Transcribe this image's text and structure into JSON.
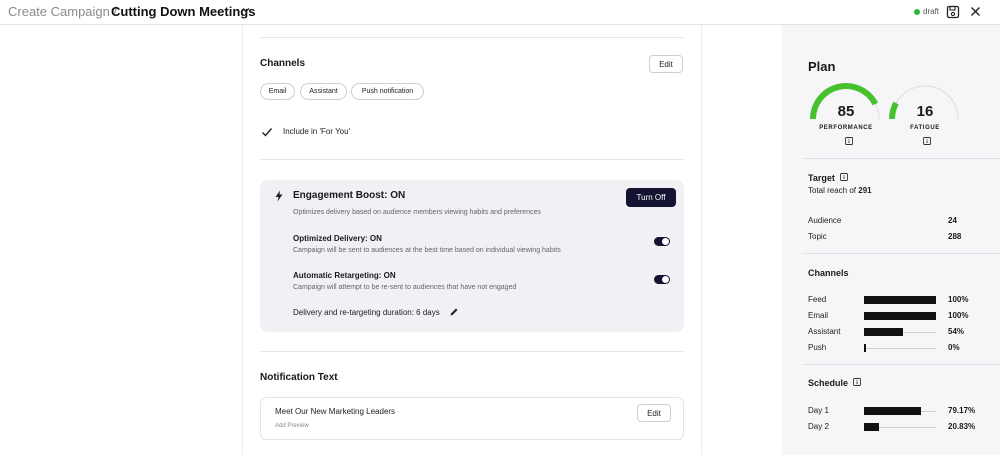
{
  "header": {
    "breadcrumb": "Create Campaign /",
    "title": "Cutting Down Meetings",
    "status": "draft",
    "status_color": "#2eb82e"
  },
  "channels": {
    "title": "Channels",
    "edit_label": "Edit",
    "chips": [
      "Email",
      "Assistant",
      "Push notification"
    ],
    "include_label": "Include in 'For You'"
  },
  "boost": {
    "title": "Engagement Boost: ON",
    "description": "Optimizes delivery based on audience members viewing habits and preferences",
    "turn_off_label": "Turn Off",
    "options": [
      {
        "title": "Optimized Delivery: ON",
        "description": "Campaign will be sent to audiences at the best time based on individual viewing habits",
        "on": true
      },
      {
        "title": "Automatic Retargeting: ON",
        "description": "Campaign will attempt to be re-sent to audiences that have not engaged",
        "on": true
      }
    ],
    "duration": "Delivery and re-targeting duration: 6 days"
  },
  "notification": {
    "title": "Notification Text",
    "text": "Meet Our New Marketing Leaders",
    "sub": "Add Preview",
    "edit_label": "Edit"
  },
  "plan": {
    "title": "Plan",
    "performance": {
      "value": "85",
      "label": "PERFORMANCE",
      "fraction": 0.85,
      "color": "#47c22e"
    },
    "fatigue": {
      "value": "16",
      "label": "FATIGUE",
      "fraction": 0.16,
      "color": "#47c22e"
    },
    "target": {
      "title": "Target",
      "reach_prefix": "Total reach of ",
      "reach_value": "291",
      "rows": [
        {
          "label": "Audience",
          "value": "24"
        },
        {
          "label": "Topic",
          "value": "288"
        }
      ]
    },
    "channels": {
      "title": "Channels",
      "rows": [
        {
          "label": "Feed",
          "value": "100%",
          "fraction": 1.0
        },
        {
          "label": "Email",
          "value": "100%",
          "fraction": 1.0
        },
        {
          "label": "Assistant",
          "value": "54%",
          "fraction": 0.54
        },
        {
          "label": "Push",
          "value": "0%",
          "fraction": 0.0
        }
      ]
    },
    "schedule": {
      "title": "Schedule",
      "rows": [
        {
          "label": "Day 1",
          "value": "79.17%",
          "fraction": 0.7917
        },
        {
          "label": "Day 2",
          "value": "20.83%",
          "fraction": 0.2083
        }
      ]
    }
  }
}
